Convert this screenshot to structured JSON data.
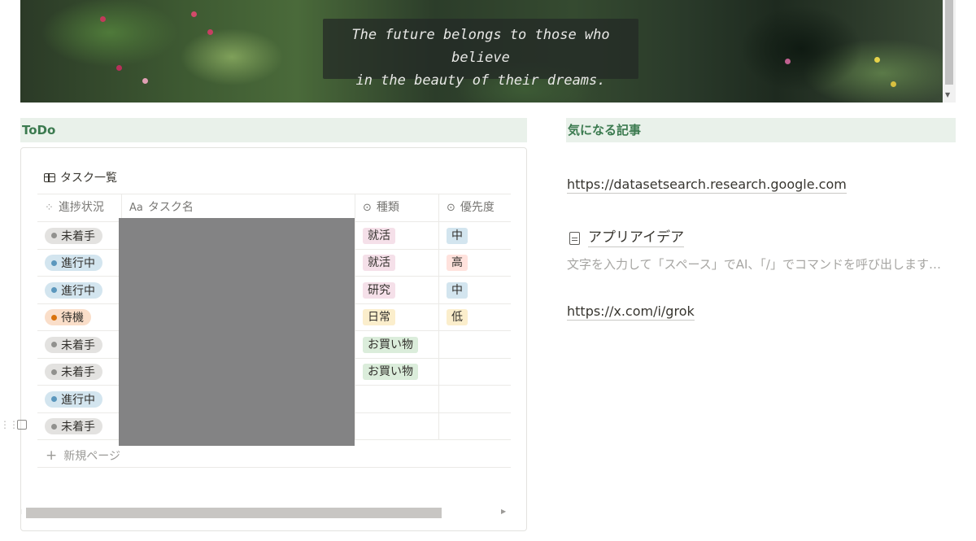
{
  "banner": {
    "quote_line1": "The future belongs to those who believe",
    "quote_line2": "in the beauty of their dreams."
  },
  "todo": {
    "section_title": "ToDo",
    "database_title": "タスク一覧",
    "columns": [
      {
        "label": "進捗状況",
        "icon": "status-spinner-icon"
      },
      {
        "label": "タスク名",
        "icon": "text-property-icon",
        "prefix": "Aa"
      },
      {
        "label": "種類",
        "icon": "select-property-icon"
      },
      {
        "label": "優先度",
        "icon": "select-property-icon"
      }
    ],
    "rows": [
      {
        "status": "未着手",
        "kind": "就活",
        "priority": "中"
      },
      {
        "status": "進行中",
        "kind": "就活",
        "priority": "高"
      },
      {
        "status": "進行中",
        "kind": "研究",
        "priority": "中"
      },
      {
        "status": "待機",
        "kind": "日常",
        "priority": "低"
      },
      {
        "status": "未着手",
        "kind": "お買い物",
        "priority": ""
      },
      {
        "status": "未着手",
        "kind": "お買い物",
        "priority": ""
      },
      {
        "status": "進行中",
        "kind": "",
        "priority": ""
      },
      {
        "status": "未着手",
        "kind": "",
        "priority": ""
      }
    ],
    "new_page_label": "新規ページ"
  },
  "articles": {
    "section_title": "気になる記事",
    "link1": "https://datasetsearch.research.google.com",
    "page_title": "アプリアイデア",
    "placeholder": "文字を入力して「スペース」でAI、「/」でコマンドを呼び出します…",
    "link2": "https://x.com/i/grok"
  },
  "colors": {
    "section_bg": "#e9f1ea",
    "section_text": "#3b7a4f",
    "status_not_started": "#e3e2e0",
    "status_in_progress": "#d3e5ef",
    "status_waiting": "#fadec9",
    "tag_job": "#f5e0e9",
    "tag_research": "#f5e0e9",
    "tag_daily": "#fbeecc",
    "tag_shopping": "#dbeddb",
    "priority_mid": "#d3e5ef",
    "priority_high": "#ffe2dd",
    "priority_low": "#fbeecc"
  }
}
